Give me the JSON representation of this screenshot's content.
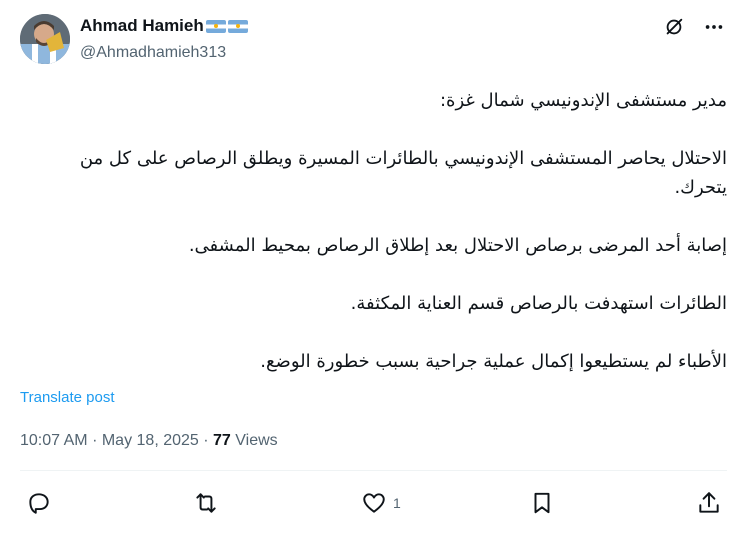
{
  "author": {
    "display_name": "Ahmad Hamieh",
    "handle": "@Ahmadhamieh313",
    "flags": [
      "argentina-flag",
      "argentina-flag"
    ]
  },
  "top_actions": {
    "grok_icon": "grok-icon",
    "more_icon": "more-icon"
  },
  "tweet": {
    "paragraphs": [
      "مدير مستشفى الإندونيسي شمال غزة:",
      "الاحتلال يحاصر المستشفى الإندونيسي بالطائرات المسيرة ويطلق الرصاص على كل من يتحرك.",
      "إصابة أحد المرضى برصاص الاحتلال بعد إطلاق الرصاص بمحيط المشفى.",
      "الطائرات استهدفت بالرصاص قسم العناية المكثفة.",
      "الأطباء لم يستطيعوا إكمال عملية جراحية بسبب خطورة الوضع."
    ]
  },
  "translate_label": "Translate post",
  "meta": {
    "time": "10:07 AM",
    "separator": "·",
    "date": "May 18, 2025",
    "views_count": "77",
    "views_label": "Views"
  },
  "actions": {
    "reply_count": "",
    "repost_count": "",
    "like_count": "1",
    "bookmark_count": ""
  },
  "colors": {
    "text": "#0f1419",
    "secondary": "#536471",
    "link": "#1d9bf0",
    "divider": "#eff3f4",
    "flag_blue": "#75aadb"
  }
}
